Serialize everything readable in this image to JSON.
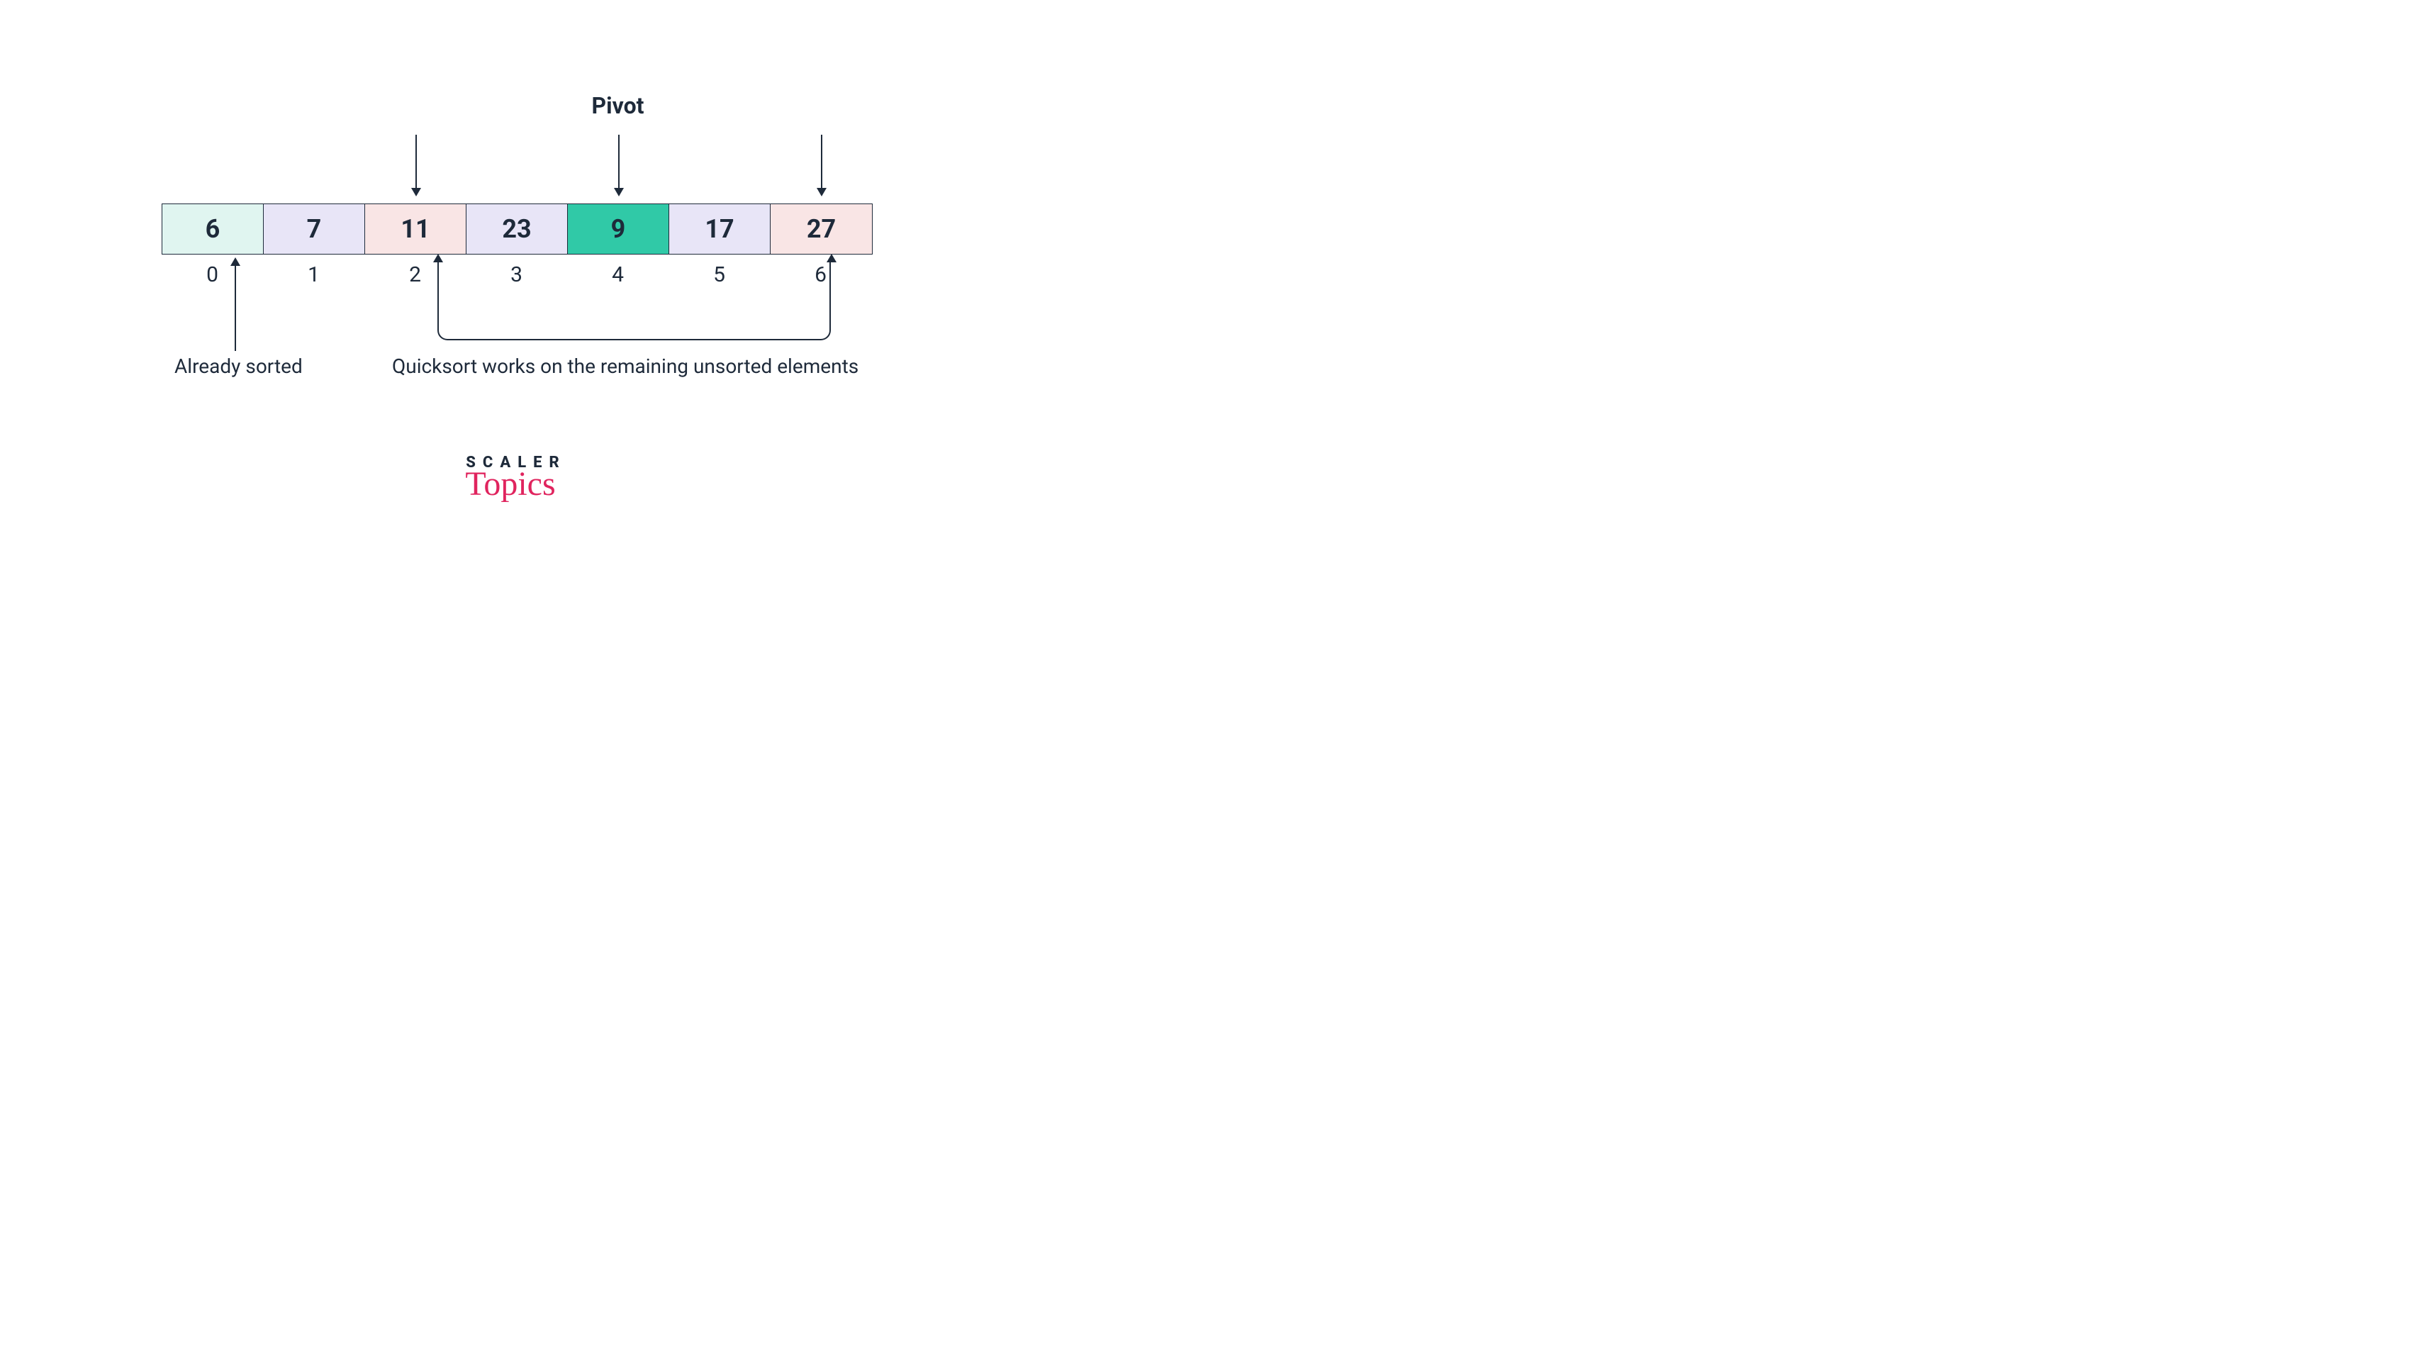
{
  "labels": {
    "pivot": "Pivot",
    "already_sorted": "Already sorted",
    "quicksort_note": "Quicksort works on the remaining unsorted elements"
  },
  "array": {
    "cells": [
      {
        "value": "6",
        "color": "mint"
      },
      {
        "value": "7",
        "color": "lav"
      },
      {
        "value": "11",
        "color": "pink"
      },
      {
        "value": "23",
        "color": "lav"
      },
      {
        "value": "9",
        "color": "teal"
      },
      {
        "value": "17",
        "color": "lav"
      },
      {
        "value": "27",
        "color": "pink"
      }
    ],
    "indices": [
      "0",
      "1",
      "2",
      "3",
      "4",
      "5",
      "6"
    ]
  },
  "top_arrows_at": [
    2,
    4,
    6
  ],
  "pivot_index": 4,
  "sorted_arrow_at": 0,
  "bracket": {
    "from": 2,
    "to": 6
  },
  "logo": {
    "brand": "SCALER",
    "sub": "Topics"
  }
}
